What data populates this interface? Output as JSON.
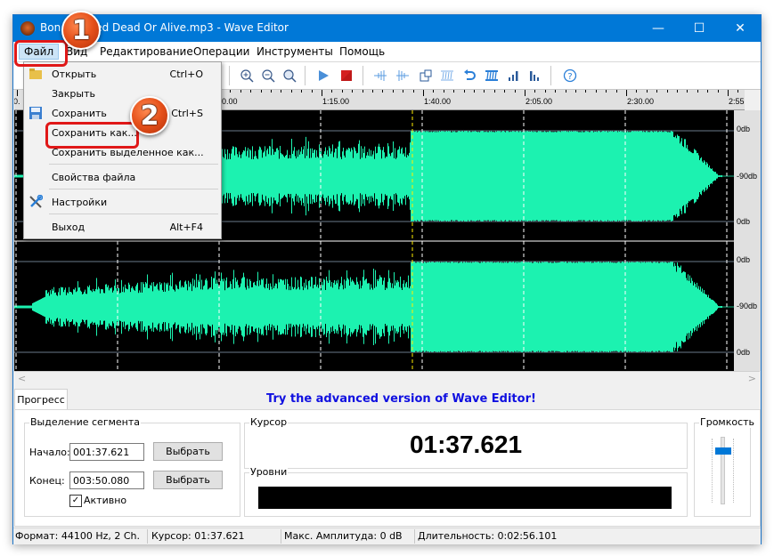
{
  "window": {
    "title": "Bon Jovi - Wanted Dead Or Alive.mp3 - Wave Editor",
    "title_visible": "Bon . . . nted Dead Or Alive.mp3 - Wave Editor",
    "controls": {
      "minimize": "—",
      "maximize": "☐",
      "close": "✕"
    }
  },
  "menubar": [
    {
      "label": "Файл",
      "active": true
    },
    {
      "label": "Вид"
    },
    {
      "label": "Редактирование"
    },
    {
      "label": "Операции"
    },
    {
      "label": "Инструменты"
    },
    {
      "label": "Помощь"
    }
  ],
  "file_menu": {
    "items": [
      {
        "label": "Открыть",
        "shortcut": "Ctrl+O",
        "icon": "folder-icon"
      },
      {
        "label": "Закрыть",
        "shortcut": ""
      },
      {
        "label": "Сохранить",
        "shortcut": "Ctrl+S",
        "icon": "floppy-icon"
      },
      {
        "label": "Сохранить как...",
        "shortcut": "",
        "highlighted": true
      },
      {
        "label": "Сохранить выделенное как...",
        "shortcut": ""
      },
      {
        "label": "Свойства файла",
        "shortcut": ""
      },
      {
        "label": "Настройки",
        "shortcut": "",
        "icon": "settings-tools-icon"
      },
      {
        "label": "Выход",
        "shortcut": "Alt+F4"
      }
    ]
  },
  "toolbar": {
    "icons": [
      "zoom-in-icon",
      "zoom-out-icon",
      "zoom-fit-icon",
      "play-icon",
      "stop-icon",
      "fade-in-icon",
      "fade-out-icon",
      "crop-icon",
      "silence-icon",
      "undo-icon",
      "normalize-icon",
      "amplify-up-icon",
      "amplify-down-icon",
      "help-icon"
    ]
  },
  "ruler": {
    "labels": [
      "0:00.00",
      "0:50.00",
      "1:15.00",
      "1:40.00",
      "2:05.00",
      "2:30.00",
      "2:55.00"
    ],
    "visible_text": [
      "0.",
      "0.00",
      "1:15.00",
      "1:40.00",
      "2:05.00",
      "2:30.00",
      "2:55.00"
    ]
  },
  "db_scale": {
    "channel1": [
      "0db",
      "-90db",
      "0db"
    ],
    "channel2": [
      "0db",
      "-90db",
      "0db"
    ]
  },
  "waveform": {
    "color": "#1cf2b0",
    "cursor_time": "01:37.621",
    "channels": 2
  },
  "bottom": {
    "tab_label": "Прогресс",
    "promo": "Try the advanced version of Wave Editor!",
    "segment": {
      "title": "Выделение сегмента",
      "start_label": "Начало:",
      "start_value": "001:37.621",
      "end_label": "Конец:",
      "end_value": "003:50.080",
      "select_label": "Выбрать",
      "active_label": "Активно",
      "active_checked": true
    },
    "cursor": {
      "title": "Курсор",
      "value": "01:37.621"
    },
    "levels": {
      "title": "Уровни"
    },
    "volume": {
      "title": "Громкость",
      "level_percent": 85
    }
  },
  "statusbar": {
    "format": "Формат: 44100 Hz, 2 Ch.",
    "cursor": "Курсор: 01:37.621",
    "max_amp": "Макс. Амплитуда: 0 dB",
    "duration": "Длительность: 0:02:56.101"
  },
  "annotations": {
    "badge1": "1",
    "badge2": "2"
  },
  "colors": {
    "titlebar": "#0078d7",
    "wave": "#1cf2b0",
    "promo": "#1010e0",
    "badge": "#e5501a"
  }
}
